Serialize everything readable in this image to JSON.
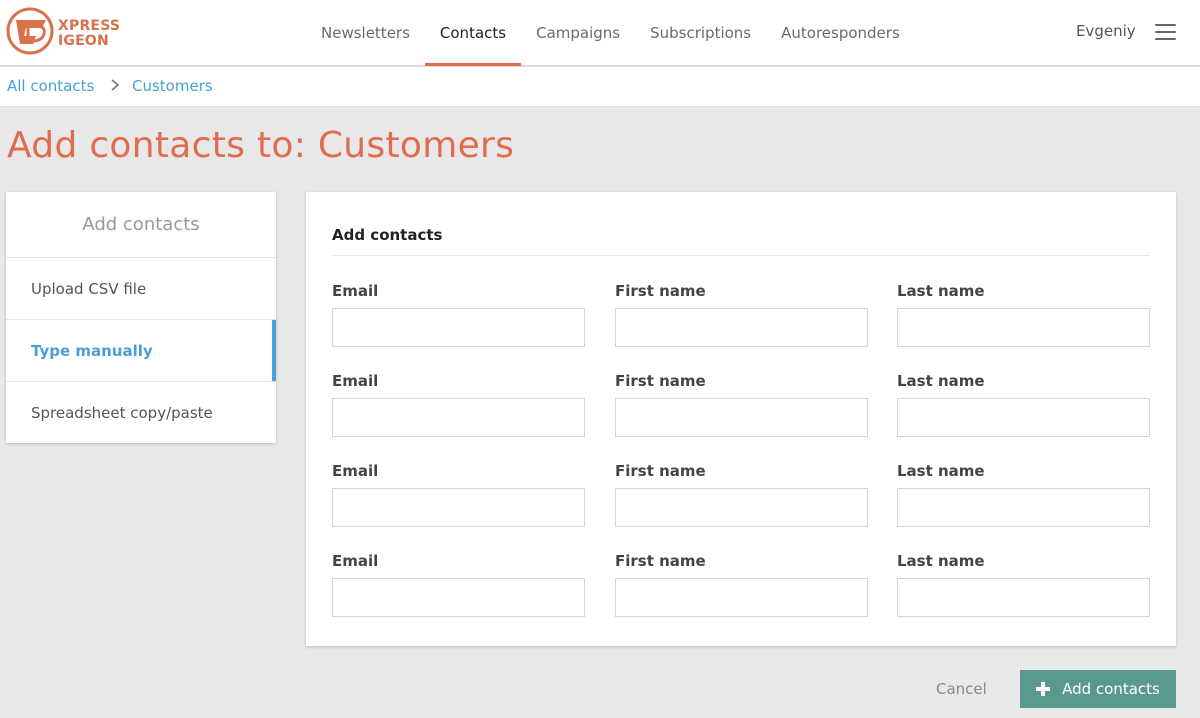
{
  "brand": {
    "line1": "XPRESS",
    "line2": "IGEON",
    "color": "#d9714a"
  },
  "nav": {
    "items": [
      {
        "label": "Newsletters",
        "active": false
      },
      {
        "label": "Contacts",
        "active": true
      },
      {
        "label": "Campaigns",
        "active": false
      },
      {
        "label": "Subscriptions",
        "active": false
      },
      {
        "label": "Autoresponders",
        "active": false
      }
    ],
    "user": "Evgeniy",
    "menu_icon": "hamburger-menu-icon"
  },
  "breadcrumb": {
    "root": "All contacts",
    "current": "Customers",
    "separator_icon": "chevron-right-icon"
  },
  "page": {
    "title": "Add contacts to: Customers"
  },
  "sidebar": {
    "heading": "Add contacts",
    "items": [
      {
        "label": "Upload CSV file",
        "active": false
      },
      {
        "label": "Type manually",
        "active": true
      },
      {
        "label": "Spreadsheet copy/paste",
        "active": false
      }
    ]
  },
  "form": {
    "title": "Add contacts",
    "rows": [
      {
        "email_label": "Email",
        "first_label": "First name",
        "last_label": "Last name",
        "email": "",
        "first": "",
        "last": ""
      },
      {
        "email_label": "Email",
        "first_label": "First name",
        "last_label": "Last name",
        "email": "",
        "first": "",
        "last": ""
      },
      {
        "email_label": "Email",
        "first_label": "First name",
        "last_label": "Last name",
        "email": "",
        "first": "",
        "last": ""
      },
      {
        "email_label": "Email",
        "first_label": "First name",
        "last_label": "Last name",
        "email": "",
        "first": "",
        "last": ""
      }
    ]
  },
  "actions": {
    "cancel": "Cancel",
    "add": "Add contacts",
    "add_icon": "plus-icon"
  },
  "colors": {
    "accent": "#e06c4e",
    "link": "#4a9fd8",
    "button": "#5a9a8e"
  }
}
